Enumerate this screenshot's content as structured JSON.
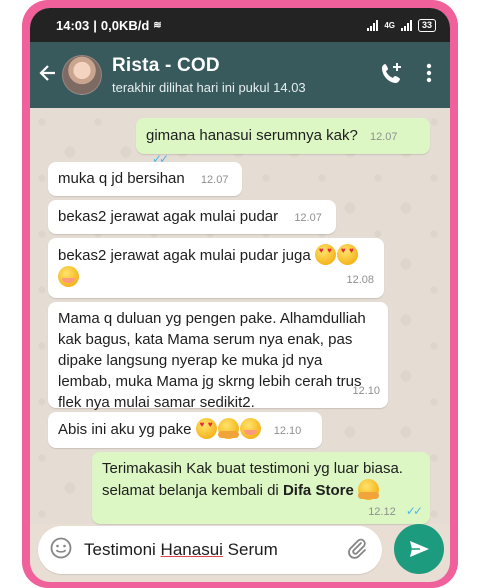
{
  "status_bar": {
    "time": "14:03",
    "data_rate": "0,0KB/d",
    "network": "4G",
    "battery": "33"
  },
  "header": {
    "contact_name": "Rista - COD",
    "last_seen": "terakhir dilihat hari ini pukul 14.03"
  },
  "messages": [
    {
      "direction": "out",
      "text": "gimana hanasui serumnya kak?",
      "time": "12.07"
    },
    {
      "direction": "in",
      "text": "muka q jd bersihan",
      "time": "12.07"
    },
    {
      "direction": "in",
      "text": "bekas2 jerawat agak mulai pudar",
      "time": "12.07"
    },
    {
      "direction": "in",
      "text": "bekas2 jerawat agak mulai pudar juga",
      "time": "12.08"
    },
    {
      "direction": "in",
      "lines": [
        "Mama q duluan yg pengen pake. Alhamdulliah",
        "kak bagus, kata Mama serum nya enak, pas",
        "dipake langsung nyerap ke muka jd nya",
        "lembab, muka Mama jg skrng lebih cerah trus",
        "flek nya mulai samar sedikit2."
      ],
      "time": "12.10"
    },
    {
      "direction": "in",
      "text": "Abis ini aku yg pake",
      "time": "12.10"
    },
    {
      "direction": "out",
      "line1": "Terimakasih Kak buat testimoni yg luar biasa.",
      "line2_prefix": "selamat belanja kembali di",
      "line2_bold": "Difa Store",
      "time": "12.12"
    }
  ],
  "composer": {
    "text_prefix": "Testimoni",
    "text_underlined": "Hanasui",
    "text_suffix": "Serum"
  },
  "colors": {
    "frame": "#f0609a",
    "header": "#385a5c",
    "outgoing_bubble": "#dcf7c4",
    "send_button": "#1d9b7e",
    "read_ticks": "#4fb6ec"
  }
}
